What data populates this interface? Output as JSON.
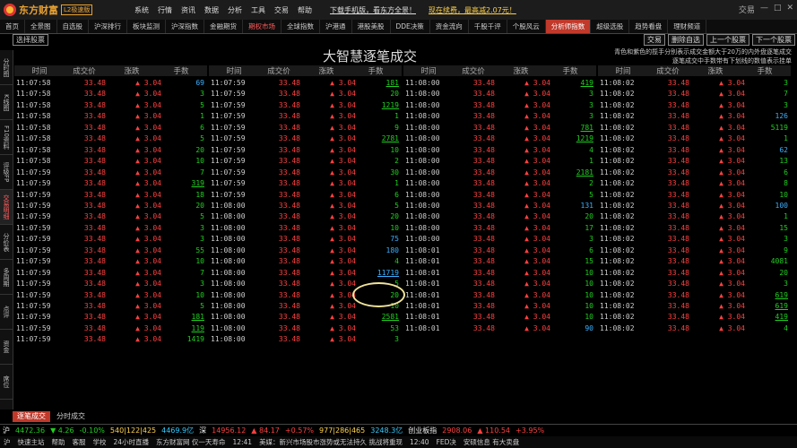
{
  "app": {
    "logo": "东方财富",
    "edition": "L2极速版"
  },
  "menu": [
    "系统",
    "行情",
    "资讯",
    "数据",
    "分析",
    "工具",
    "交易",
    "帮助"
  ],
  "promo": {
    "left": "下载手机版，看东方全景！",
    "right": "现在续费，最高减2.07元！"
  },
  "window_buttons": [
    "交易",
    "—",
    "□",
    "✕"
  ],
  "nav": [
    "首页",
    "全景图",
    "自选股",
    "沪深排行",
    "板块监测",
    "沪深指数",
    "金融期货",
    "期权市场",
    "全球指数",
    "沪港通",
    "港股美股",
    "DDE决策",
    "资金流向",
    "千股千评",
    "个股风云",
    "分析师指数",
    "超级选股",
    "趋势看盘",
    "理财频道"
  ],
  "side_tabs": [
    "分时图",
    "K线图",
    "F10资料",
    "评级FP",
    "交易明细",
    "分价表",
    "多周期",
    "点评",
    "资金",
    "席位"
  ],
  "filter_button": "选择股票",
  "title": "大智慧逐笔成交",
  "right_buttons": [
    "交易",
    "删除自选",
    "上一个股票",
    "下一个股票"
  ],
  "note": [
    "青色和紫色的揽手分别表示成交金额大于20万的内外盘逐笔成交",
    "逐笔成交中手数带有下划线的数值表示挂单"
  ],
  "headers": [
    "时间",
    "成交价",
    "涨跌",
    "手数"
  ],
  "columns": [
    [
      [
        "11:07:58",
        "33.48",
        "▲ 3.04",
        "69",
        "b"
      ],
      [
        "11:07:58",
        "33.48",
        "▲ 3.04",
        "3",
        "g"
      ],
      [
        "11:07:58",
        "33.48",
        "▲ 3.04",
        "5",
        "g"
      ],
      [
        "11:07:58",
        "33.48",
        "▲ 3.04",
        "1",
        "g"
      ],
      [
        "11:07:58",
        "33.48",
        "▲ 3.04",
        "6",
        "g"
      ],
      [
        "11:07:58",
        "33.48",
        "▲ 3.04",
        "5",
        "g"
      ],
      [
        "11:07:58",
        "33.48",
        "▲ 3.04",
        "20",
        "g"
      ],
      [
        "11:07:58",
        "33.48",
        "▲ 3.04",
        "10",
        "g"
      ],
      [
        "11:07:59",
        "33.48",
        "▲ 3.04",
        "7",
        "g"
      ],
      [
        "11:07:59",
        "33.48",
        "▲ 3.04",
        "319",
        "gu"
      ],
      [
        "11:07:59",
        "33.48",
        "▲ 3.04",
        "18",
        "g"
      ],
      [
        "11:07:59",
        "33.48",
        "▲ 3.04",
        "20",
        "g"
      ],
      [
        "11:07:59",
        "33.48",
        "▲ 3.04",
        "5",
        "g"
      ],
      [
        "11:07:59",
        "33.48",
        "▲ 3.04",
        "3",
        "g"
      ],
      [
        "11:07:59",
        "33.48",
        "▲ 3.04",
        "3",
        "g"
      ],
      [
        "11:07:59",
        "33.48",
        "▲ 3.04",
        "55",
        "g"
      ],
      [
        "11:07:59",
        "33.48",
        "▲ 3.04",
        "10",
        "g"
      ],
      [
        "11:07:59",
        "33.48",
        "▲ 3.04",
        "7",
        "g"
      ],
      [
        "11:07:59",
        "33.48",
        "▲ 3.04",
        "3",
        "g"
      ],
      [
        "11:07:59",
        "33.48",
        "▲ 3.04",
        "10",
        "g"
      ],
      [
        "11:07:59",
        "33.48",
        "▲ 3.04",
        "5",
        "g"
      ],
      [
        "11:07:59",
        "33.48",
        "▲ 3.04",
        "181",
        "gu"
      ],
      [
        "11:07:59",
        "33.48",
        "▲ 3.04",
        "119",
        "gu"
      ],
      [
        "11:07:59",
        "33.48",
        "▲ 3.04",
        "1419",
        "g"
      ]
    ],
    [
      [
        "11:07:59",
        "33.48",
        "▲ 3.04",
        "181",
        "gu"
      ],
      [
        "11:07:59",
        "33.48",
        "▲ 3.04",
        "20",
        "g"
      ],
      [
        "11:07:59",
        "33.48",
        "▲ 3.04",
        "1219",
        "gu"
      ],
      [
        "11:07:59",
        "33.48",
        "▲ 3.04",
        "1",
        "g"
      ],
      [
        "11:07:59",
        "33.48",
        "▲ 3.04",
        "9",
        "g"
      ],
      [
        "11:07:59",
        "33.48",
        "▲ 3.04",
        "2781",
        "gu"
      ],
      [
        "11:07:59",
        "33.48",
        "▲ 3.04",
        "10",
        "g"
      ],
      [
        "11:07:59",
        "33.48",
        "▲ 3.04",
        "2",
        "g"
      ],
      [
        "11:07:59",
        "33.48",
        "▲ 3.04",
        "30",
        "g"
      ],
      [
        "11:07:59",
        "33.48",
        "▲ 3.04",
        "1",
        "g"
      ],
      [
        "11:07:59",
        "33.48",
        "▲ 3.04",
        "6",
        "g"
      ],
      [
        "11:08:00",
        "33.48",
        "▲ 3.04",
        "5",
        "g"
      ],
      [
        "11:08:00",
        "33.48",
        "▲ 3.04",
        "20",
        "g"
      ],
      [
        "11:08:00",
        "33.48",
        "▲ 3.04",
        "10",
        "g"
      ],
      [
        "11:08:00",
        "33.48",
        "▲ 3.04",
        "75",
        "b"
      ],
      [
        "11:08:00",
        "33.48",
        "▲ 3.04",
        "180",
        "b"
      ],
      [
        "11:08:00",
        "33.48",
        "▲ 3.04",
        "4",
        "g"
      ],
      [
        "11:08:00",
        "33.48",
        "▲ 3.04",
        "11719",
        "bu"
      ],
      [
        "11:08:00",
        "33.48",
        "▲ 3.04",
        "5",
        "g"
      ],
      [
        "11:08:00",
        "33.48",
        "▲ 3.04",
        "20",
        "g"
      ],
      [
        "11:08:00",
        "33.48",
        "▲ 3.04",
        "10",
        "g"
      ],
      [
        "11:08:00",
        "33.48",
        "▲ 3.04",
        "2581",
        "gu"
      ],
      [
        "11:08:00",
        "33.48",
        "▲ 3.04",
        "53",
        "g"
      ],
      [
        "11:08:00",
        "33.48",
        "▲ 3.04",
        "3",
        "g"
      ]
    ],
    [
      [
        "11:08:00",
        "33.48",
        "▲ 3.04",
        "419",
        "gu"
      ],
      [
        "11:08:00",
        "33.48",
        "▲ 3.04",
        "3",
        "g"
      ],
      [
        "11:08:00",
        "33.48",
        "▲ 3.04",
        "3",
        "g"
      ],
      [
        "11:08:00",
        "33.48",
        "▲ 3.04",
        "3",
        "g"
      ],
      [
        "11:08:00",
        "33.48",
        "▲ 3.04",
        "781",
        "gu"
      ],
      [
        "11:08:00",
        "33.48",
        "▲ 3.04",
        "1219",
        "gu"
      ],
      [
        "11:08:00",
        "33.48",
        "▲ 3.04",
        "4",
        "g"
      ],
      [
        "11:08:00",
        "33.48",
        "▲ 3.04",
        "1",
        "g"
      ],
      [
        "11:08:00",
        "33.48",
        "▲ 3.04",
        "2181",
        "gu"
      ],
      [
        "11:08:00",
        "33.48",
        "▲ 3.04",
        "2",
        "g"
      ],
      [
        "11:08:00",
        "33.48",
        "▲ 3.04",
        "5",
        "g"
      ],
      [
        "11:08:00",
        "33.48",
        "▲ 3.04",
        "131",
        "b"
      ],
      [
        "11:08:00",
        "33.48",
        "▲ 3.04",
        "20",
        "g"
      ],
      [
        "11:08:00",
        "33.48",
        "▲ 3.04",
        "17",
        "g"
      ],
      [
        "11:08:00",
        "33.48",
        "▲ 3.04",
        "3",
        "g"
      ],
      [
        "11:08:01",
        "33.48",
        "▲ 3.04",
        "6",
        "g"
      ],
      [
        "11:08:01",
        "33.48",
        "▲ 3.04",
        "15",
        "g"
      ],
      [
        "11:08:01",
        "33.48",
        "▲ 3.04",
        "10",
        "g"
      ],
      [
        "11:08:01",
        "33.48",
        "▲ 3.04",
        "10",
        "g"
      ],
      [
        "11:08:01",
        "33.48",
        "▲ 3.04",
        "10",
        "g"
      ],
      [
        "11:08:01",
        "33.48",
        "▲ 3.04",
        "10",
        "g"
      ],
      [
        "11:08:01",
        "33.48",
        "▲ 3.04",
        "10",
        "g"
      ],
      [
        "11:08:01",
        "33.48",
        "▲ 3.04",
        "90",
        "b"
      ]
    ],
    [
      [
        "11:08:02",
        "33.48",
        "▲ 3.04",
        "3",
        "g"
      ],
      [
        "11:08:02",
        "33.48",
        "▲ 3.04",
        "7",
        "g"
      ],
      [
        "11:08:02",
        "33.48",
        "▲ 3.04",
        "3",
        "g"
      ],
      [
        "11:08:02",
        "33.48",
        "▲ 3.04",
        "126",
        "b"
      ],
      [
        "11:08:02",
        "33.48",
        "▲ 3.04",
        "5119",
        "g"
      ],
      [
        "11:08:02",
        "33.48",
        "▲ 3.04",
        "1",
        "g"
      ],
      [
        "11:08:02",
        "33.48",
        "▲ 3.04",
        "62",
        "b"
      ],
      [
        "11:08:02",
        "33.48",
        "▲ 3.04",
        "13",
        "g"
      ],
      [
        "11:08:02",
        "33.48",
        "▲ 3.04",
        "6",
        "g"
      ],
      [
        "11:08:02",
        "33.48",
        "▲ 3.04",
        "8",
        "g"
      ],
      [
        "11:08:02",
        "33.48",
        "▲ 3.04",
        "10",
        "g"
      ],
      [
        "11:08:02",
        "33.48",
        "▲ 3.04",
        "100",
        "b"
      ],
      [
        "11:08:02",
        "33.48",
        "▲ 3.04",
        "1",
        "g"
      ],
      [
        "11:08:02",
        "33.48",
        "▲ 3.04",
        "15",
        "g"
      ],
      [
        "11:08:02",
        "33.48",
        "▲ 3.04",
        "3",
        "g"
      ],
      [
        "11:08:02",
        "33.48",
        "▲ 3.04",
        "9",
        "g"
      ],
      [
        "11:08:02",
        "33.48",
        "▲ 3.04",
        "4081",
        "g"
      ],
      [
        "11:08:02",
        "33.48",
        "▲ 3.04",
        "20",
        "g"
      ],
      [
        "11:08:02",
        "33.48",
        "▲ 3.04",
        "3",
        "g"
      ],
      [
        "11:08:02",
        "33.48",
        "▲ 3.04",
        "619",
        "gu"
      ],
      [
        "11:08:02",
        "33.48",
        "▲ 3.04",
        "619",
        "gu"
      ],
      [
        "11:08:02",
        "33.48",
        "▲ 3.04",
        "419",
        "gu"
      ],
      [
        "11:08:02",
        "33.48",
        "▲ 3.04",
        "4",
        "g"
      ]
    ]
  ],
  "tabs": [
    "逐笔成交",
    "分时成交"
  ],
  "status": {
    "sh": "沪",
    "sh_index": "4472.36",
    "sh_chg": "▼ 4.26",
    "sh_pct": "-0.10%",
    "sh_cnt": "540|122|425",
    "sh_amt": "4469.9亿",
    "sz": "深",
    "sz_index": "14956.12",
    "sz_chg": "▲ 84.17",
    "sz_pct": "+0.57%",
    "sz_cnt": "977|286|465",
    "sz_amt": "3248.3亿",
    "cy": "创业板指",
    "cy_index": "2908.06",
    "cy_chg": "▲ 110.54",
    "cy_pct": "+3.95%"
  },
  "bottom": [
    "沪",
    "快速主站",
    "帮助",
    "客服",
    "学校",
    "24小时直播",
    "东方财富网 仅一天寿命",
    "12:41",
    "美媒：新兴市场股市涨势或无法持久 挑战将重现",
    "12:40",
    "FED决",
    "安硕信息 有大卖盘"
  ]
}
